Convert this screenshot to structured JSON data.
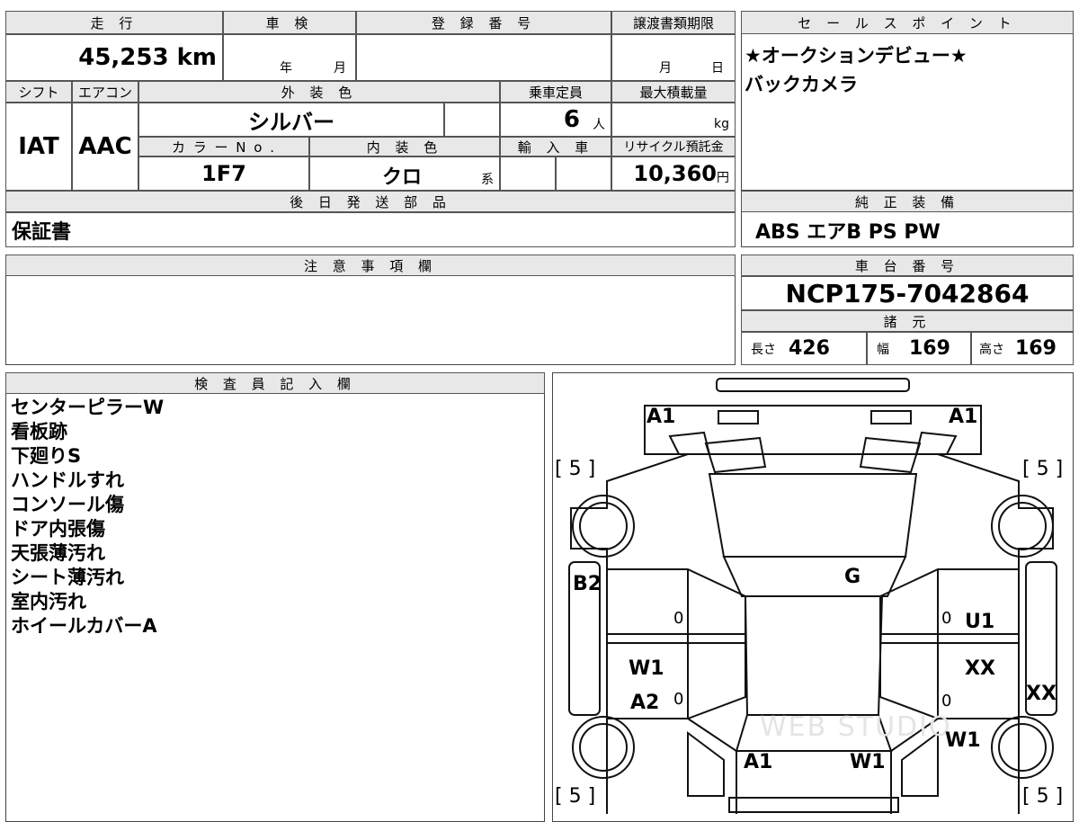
{
  "top": {
    "mileage_label": "走 行",
    "inspection_label": "車 検",
    "reg_label": "登 録 番 号",
    "transfer_label": "譲渡書類期限",
    "mileage_value": "45,253 km",
    "year_unit": "年",
    "month_unit": "月",
    "transfer_month": "月",
    "transfer_day": "日",
    "shift_label": "シフト",
    "ac_label": "エアコン",
    "exterior_label": "外 装 色",
    "capacity_label": "乗車定員",
    "load_label": "最大積載量",
    "shift_value": "IAT",
    "ac_value": "AAC",
    "exterior_value": "シルバー",
    "capacity_value": "6",
    "capacity_unit": "人",
    "load_unit": "kg",
    "color_no_label": "カ ラ ー N o .",
    "interior_label": "内 装 色",
    "import_label": "輸 入 車",
    "recycle_label": "リサイクル預託金",
    "color_no_value": "1F7",
    "interior_value": "クロ",
    "interior_unit": "系",
    "recycle_value": "10,360",
    "recycle_unit": "円",
    "later_parts_label": "後 日 発 送 部 品",
    "later_parts_value": "保証書"
  },
  "sales": {
    "label": "セ ー ル ス ポ イ ン ト",
    "lines": [
      "★オークションデビュー★",
      "バックカメラ"
    ],
    "equipment_label": "純 正 装 備",
    "equipment_value": "ABS エアB PS PW"
  },
  "notes": {
    "label": "注 意 事 項 欄"
  },
  "chassis": {
    "label": "車 台 番 号",
    "value": "NCP175-7042864",
    "spec_label": "諸 元",
    "length_label": "長さ",
    "length_value": "426",
    "width_label": "幅",
    "width_value": "169",
    "height_label": "高さ",
    "height_value": "169"
  },
  "inspector": {
    "label": "検 査 員 記 入 欄",
    "lines": [
      "センターピラーW",
      "看板跡",
      "下廻りS",
      "ハンドルすれ",
      "コンソール傷",
      "ドア内張傷",
      "天張薄汚れ",
      "シート薄汚れ",
      "室内汚れ",
      "ホイールカバーA"
    ]
  },
  "diagram": {
    "marks": {
      "a1_front_left": "A1",
      "a1_front_right": "A1",
      "tire_fl": "[ 5 ]",
      "tire_fr": "[ 5 ]",
      "tire_rl": "[ 5 ]",
      "tire_rr": "[ 5 ]",
      "b2": "B2",
      "g": "G",
      "u1": "U1",
      "w1_left": "W1",
      "a2": "A2",
      "xx_right_door": "XX",
      "xx_right_panel": "XX",
      "w1_right": "W1",
      "a1_rear": "A1",
      "w1_rear": "W1",
      "zero_1": "0",
      "zero_2": "0",
      "zero_3": "0",
      "zero_4": "0"
    },
    "watermark": "WEB STUDIO"
  }
}
